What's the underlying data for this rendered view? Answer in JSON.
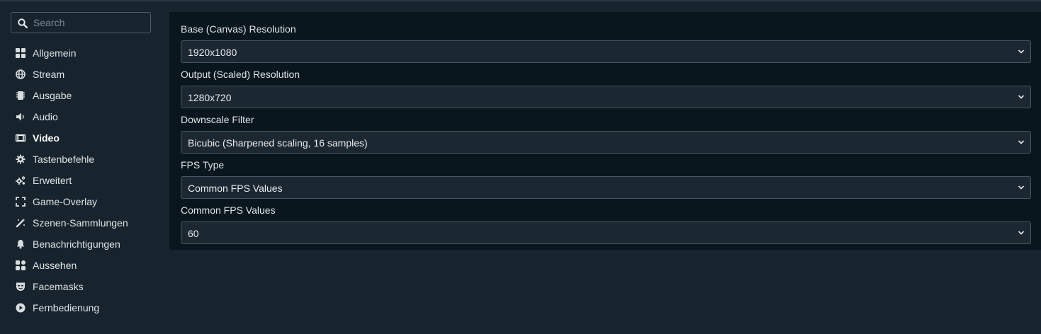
{
  "search": {
    "placeholder": "Search"
  },
  "sidebar": {
    "items": [
      {
        "label": "Allgemein",
        "icon": "grid-icon"
      },
      {
        "label": "Stream",
        "icon": "globe-icon"
      },
      {
        "label": "Ausgabe",
        "icon": "chip-icon"
      },
      {
        "label": "Audio",
        "icon": "speaker-icon"
      },
      {
        "label": "Video",
        "icon": "film-icon",
        "active": true
      },
      {
        "label": "Tastenbefehle",
        "icon": "gear-icon"
      },
      {
        "label": "Erweitert",
        "icon": "gears-icon"
      },
      {
        "label": "Game-Overlay",
        "icon": "expand-icon"
      },
      {
        "label": "Szenen-Sammlungen",
        "icon": "magic-wand-icon"
      },
      {
        "label": "Benachrichtigungen",
        "icon": "bell-icon"
      },
      {
        "label": "Aussehen",
        "icon": "widgets-icon"
      },
      {
        "label": "Facemasks",
        "icon": "mask-icon"
      },
      {
        "label": "Fernbedienung",
        "icon": "play-circle-icon"
      }
    ]
  },
  "video": {
    "fields": [
      {
        "label": "Base (Canvas) Resolution",
        "value": "1920x1080"
      },
      {
        "label": "Output (Scaled) Resolution",
        "value": "1280x720"
      },
      {
        "label": "Downscale Filter",
        "value": "Bicubic (Sharpened scaling, 16 samples)"
      },
      {
        "label": "FPS Type",
        "value": "Common FPS Values"
      },
      {
        "label": "Common FPS Values",
        "value": "60"
      }
    ]
  },
  "colors": {
    "background": "#17242d",
    "panel": "#09161d",
    "select_bg": "#1b2731",
    "select_border": "#4a5660",
    "text": "#dfe3e6"
  }
}
